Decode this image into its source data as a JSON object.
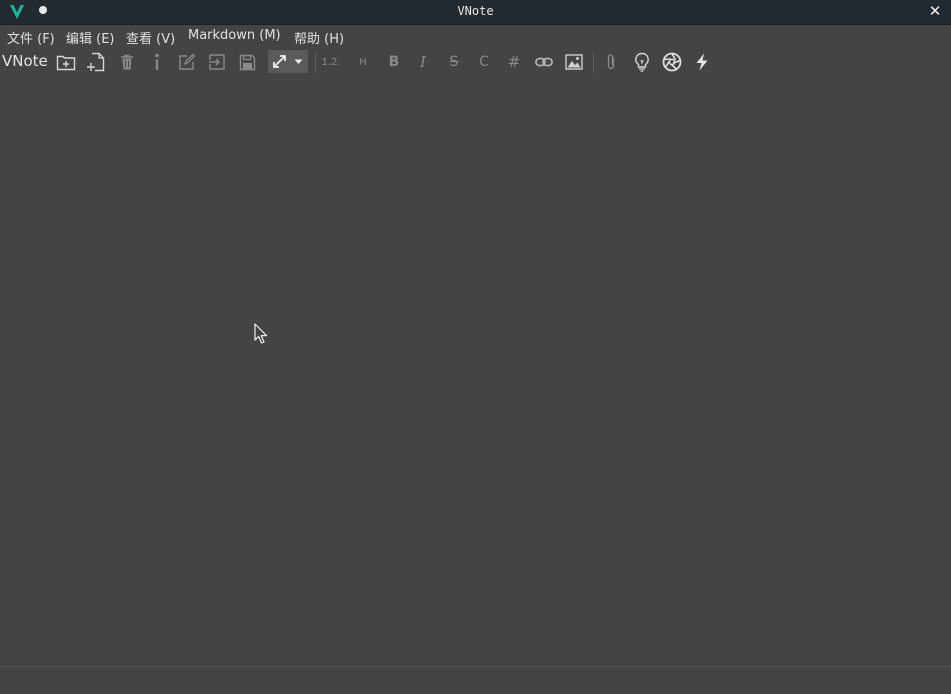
{
  "window": {
    "title": "VNote",
    "close_glyph": "✕"
  },
  "menu": [
    {
      "label": "文件 (F)"
    },
    {
      "label": "编辑 (E)"
    },
    {
      "label": "查看 (V)"
    },
    {
      "label": "Markdown (M)"
    },
    {
      "label": "帮助 (H)"
    }
  ],
  "toolbar": {
    "label": "VNote",
    "numbered_list_text": "1.2.",
    "heading_text": "H",
    "bold_text": "B",
    "italic_text": "I",
    "strike_text": "S",
    "code_text": "C",
    "hash_text": "#",
    "icons": [
      "new-notebook-icon",
      "new-note-icon",
      "delete-icon",
      "info-icon",
      "edit-icon",
      "export-icon",
      "save-icon",
      "expand-icon",
      "link-icon",
      "image-icon",
      "attachment-icon",
      "tip-icon",
      "aperture-icon",
      "lightning-icon"
    ]
  },
  "colors": {
    "background": "#444444",
    "titlebar": "#232b31",
    "accent": "#19b6a2",
    "icon": "#d6d6d6",
    "icon_disabled": "#8a8a8a"
  }
}
